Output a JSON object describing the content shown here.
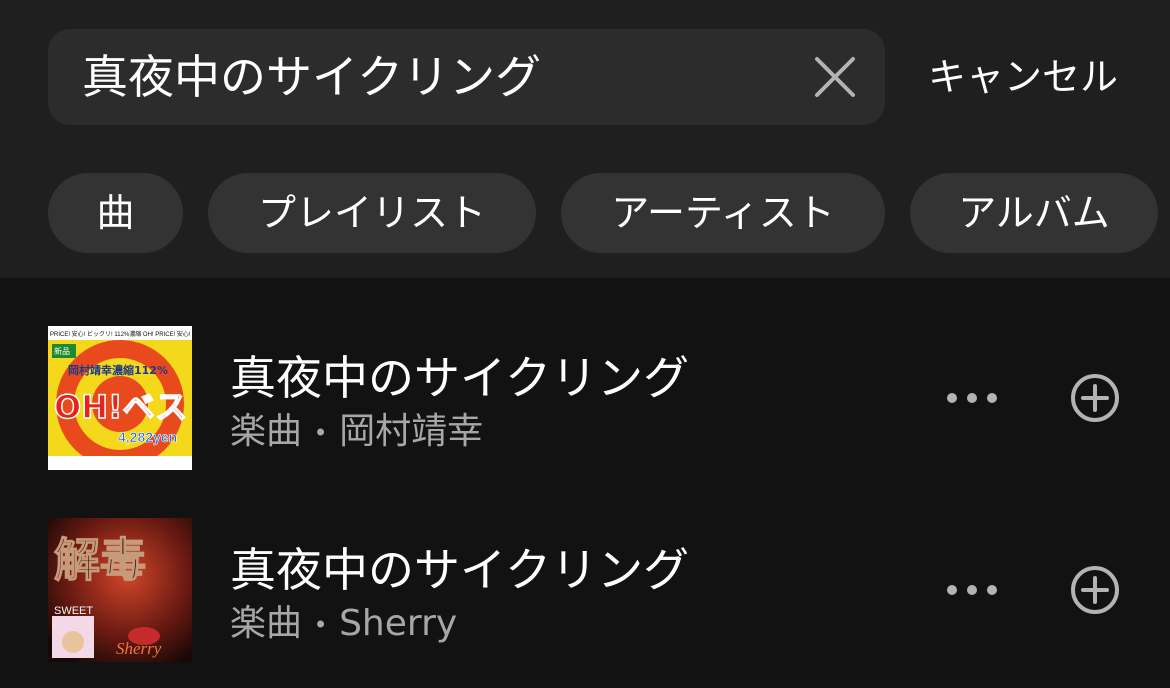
{
  "search": {
    "query": "真夜中のサイクリング",
    "cancel_label": "キャンセル"
  },
  "filters": [
    {
      "label": "曲"
    },
    {
      "label": "プレイリスト"
    },
    {
      "label": "アーティスト"
    },
    {
      "label": "アルバム"
    }
  ],
  "results": [
    {
      "title": "真夜中のサイクリング",
      "type": "楽曲",
      "separator": "•",
      "artist": "岡村靖幸",
      "cover": {
        "top_text": "PRICE! 安心! ビックリ! 112%濃縮 OH! PRICE! 安心!",
        "badge": "新品",
        "subtitle": "岡村靖幸濃縮112%",
        "title": "OH!ベスト",
        "price": "4,282yen"
      }
    },
    {
      "title": "真夜中のサイクリング",
      "type": "楽曲",
      "separator": "•",
      "artist": "Sherry",
      "cover": {
        "title": "解毒",
        "sub": "SWEET",
        "artist": "Sherry"
      }
    }
  ],
  "colors": {
    "background": "#121212",
    "header": "#1f1f1f",
    "search_box": "#2c2c2c",
    "chip": "#333333",
    "secondary_text": "#a7a7a7"
  },
  "icons": {
    "clear": "close-icon",
    "more": "more-icon",
    "add": "add-circle-icon"
  }
}
